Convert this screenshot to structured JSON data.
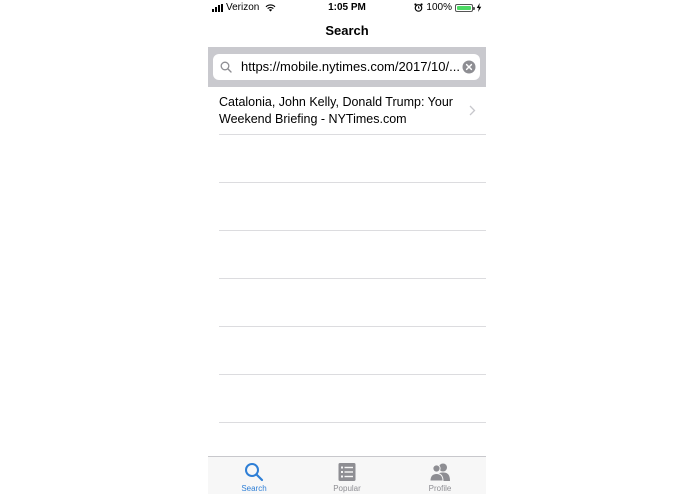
{
  "status_bar": {
    "carrier": "Verizon",
    "time": "1:05 PM",
    "battery": "100%",
    "battery_level": 1.0
  },
  "nav": {
    "title": "Search"
  },
  "search": {
    "value": "https://mobile.nytimes.com/2017/10/..."
  },
  "results": [
    {
      "title": "Catalonia, John Kelly, Donald Trump: Your Weekend Briefing - NYTimes.com"
    }
  ],
  "tabs": [
    {
      "label": "Search",
      "icon": "search-icon",
      "active": true
    },
    {
      "label": "Popular",
      "icon": "list-icon",
      "active": false
    },
    {
      "label": "Profile",
      "icon": "profile-icon",
      "active": false
    }
  ],
  "colors": {
    "accent": "#2f7fd6",
    "inactive_tab": "#8e8e93",
    "search_band": "#c9c9ce",
    "battery": "#4cd964"
  }
}
